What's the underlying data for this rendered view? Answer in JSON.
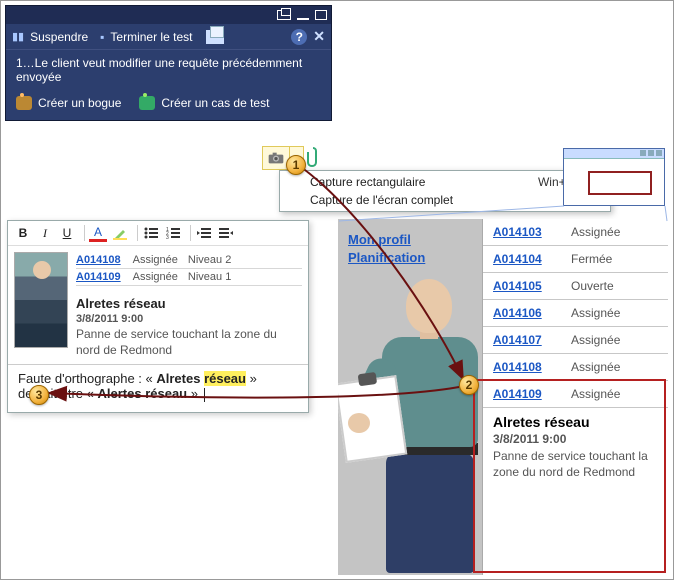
{
  "runner": {
    "suspend": "Suspendre",
    "end_test": "Terminer le test",
    "step_text": "1…Le client veut modifier une requête précédemment envoyée",
    "create_bug": "Créer un bogue",
    "create_testcase": "Créer un cas de test"
  },
  "capture_menu": {
    "rect": "Capture rectangulaire",
    "rect_shortcut": "Win+Ctrl+C",
    "full": "Capture de l'écran complet"
  },
  "editor": {
    "toolbar": {
      "bold": "B",
      "italic": "I",
      "underline": "U",
      "font_color": "A"
    },
    "rows": [
      {
        "id": "A014108",
        "status": "Assignée",
        "level": "Niveau 2"
      },
      {
        "id": "A014109",
        "status": "Assignée",
        "level": "Niveau 1"
      }
    ],
    "card": {
      "title": "Alretes réseau",
      "datetime": "3/8/2011 9:00",
      "desc": "Panne de service touchant la zone du nord de Redmond"
    },
    "note_prefix": "Faute d'orthographe : « ",
    "note_hl": "Alretes réseau",
    "note_mid": " » devrait être « ",
    "note_fix": "Alertes réseau",
    "note_suffix": " »."
  },
  "app": {
    "links": {
      "profile": "Mon profil",
      "planning": "Planification"
    },
    "rows": [
      {
        "id": "A014103",
        "status": "Assignée"
      },
      {
        "id": "A014104",
        "status": "Fermée"
      },
      {
        "id": "A014105",
        "status": "Ouverte"
      },
      {
        "id": "A014106",
        "status": "Assignée"
      },
      {
        "id": "A014107",
        "status": "Assignée"
      },
      {
        "id": "A014108",
        "status": "Assignée"
      },
      {
        "id": "A014109",
        "status": "Assignée"
      }
    ],
    "detail": {
      "title": "Alretes réseau",
      "datetime": "3/8/2011 9:00",
      "desc": "Panne de service touchant la zone du nord de Redmond"
    }
  },
  "badges": {
    "one": "1",
    "two": "2",
    "three": "3"
  }
}
